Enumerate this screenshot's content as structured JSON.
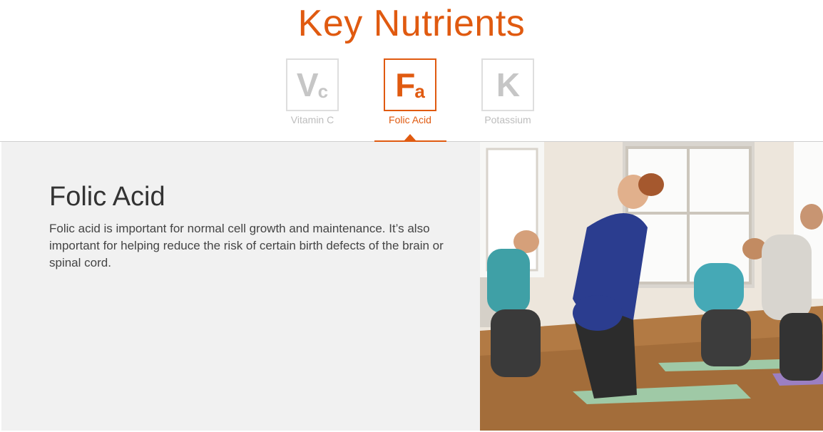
{
  "header": {
    "title": "Key Nutrients"
  },
  "tabs": [
    {
      "symbol_main": "V",
      "symbol_sub": "c",
      "label": "Vitamin C",
      "active": false
    },
    {
      "symbol_main": "F",
      "symbol_sub": "a",
      "label": "Folic Acid",
      "active": true
    },
    {
      "symbol_main": "K",
      "symbol_sub": "",
      "label": "Potassium",
      "active": false
    }
  ],
  "detail": {
    "heading": "Folic Acid",
    "body": "Folic acid is important for normal cell growth and maintenance. It’s also important for helping reduce the risk of certain birth defects of the brain or spinal cord."
  },
  "colors": {
    "accent": "#e05a10",
    "inactive": "#c6c6c6",
    "panel": "#f1f1f1"
  }
}
